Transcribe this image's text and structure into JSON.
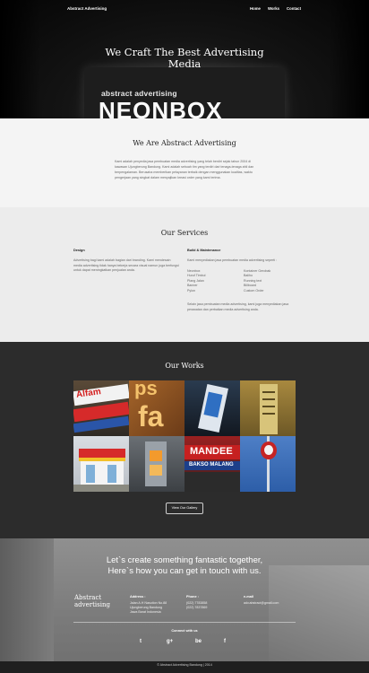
{
  "nav": {
    "brand": "Abstract Advertising",
    "links": [
      "Home",
      "Works",
      "Contact"
    ]
  },
  "hero": {
    "title_line1": "We Craft The Best Advertising",
    "title_line2": "Media",
    "sign_small": "abstract advertising",
    "sign_big": "NEONBOX"
  },
  "about": {
    "title": "We Are Abstract Advertising",
    "body": "Kami adalah penyedia jasa pembuatan media advertising yang telah berdiri sejak tahun 2004 di kawasan Ujungberung Bandung. Kami adalah sebuah tim yang terdiri dari tenaga-tenaga ahli dan berpengalaman. Berusaha memberikan pelayanan terbaik dengan menggunakan kualitas, waktu pengerjaan yang singkat dalam menyajikan kreasi order yang kami terima."
  },
  "services": {
    "title": "Our Services",
    "design": {
      "heading": "Design",
      "body": "Advertising bagi kami adalah bagian dari branding. Kami mendesain media advertising tidak hanya bekerja secara visual namun juga berfungsi untuk dapat meningkatkan penjualan anda."
    },
    "build": {
      "heading": "Build & Maintenance",
      "intro": "Kami menyediakan jasa pembuatan media advertising seperti :",
      "col1": [
        "Neonbox",
        "Huruf Timbul",
        "Plang Jalan",
        "Banner",
        "Pylon"
      ],
      "col2": [
        "Kontainer Gerobak",
        "Baliho",
        "Running text",
        "Billboard",
        "Custom Order"
      ],
      "outro": "Selain jasa pembuatan media advertising, kami juga menyediakan jasa perawatan dan perbaikan media advertising anda."
    }
  },
  "works": {
    "title": "Our Works",
    "tiles": [
      "Alfamart neonbox",
      "Huruf timbul",
      "Pylon",
      "Plang directory",
      "Alfamart store front",
      "Huruf timbul 2",
      "Mandee Bakso Malang",
      "KFC pylon"
    ],
    "button": "View Our Gallery"
  },
  "contact": {
    "title_line1": "Let`s create something fantastic together,",
    "title_line2": "Here`s how you can get in touch with us.",
    "brand_line1": "Abstract",
    "brand_line2": "advertising",
    "address_label": "Address :",
    "address_lines": [
      "Jalan A.H Nasution No.88",
      "Ujungberung Bandung",
      "Jawa Barat Indonesia"
    ],
    "phone_label": "Phone :",
    "phone_lines": [
      "(022) 7783858",
      "(022) 7837869"
    ],
    "email_label": "e-mail",
    "email_value": "adv.abstract@gmail.com",
    "connect": "Connect with us",
    "social": [
      "t",
      "g+",
      "be",
      "f"
    ]
  },
  "footer": "© Abstract Advertising Bandung | 2014"
}
